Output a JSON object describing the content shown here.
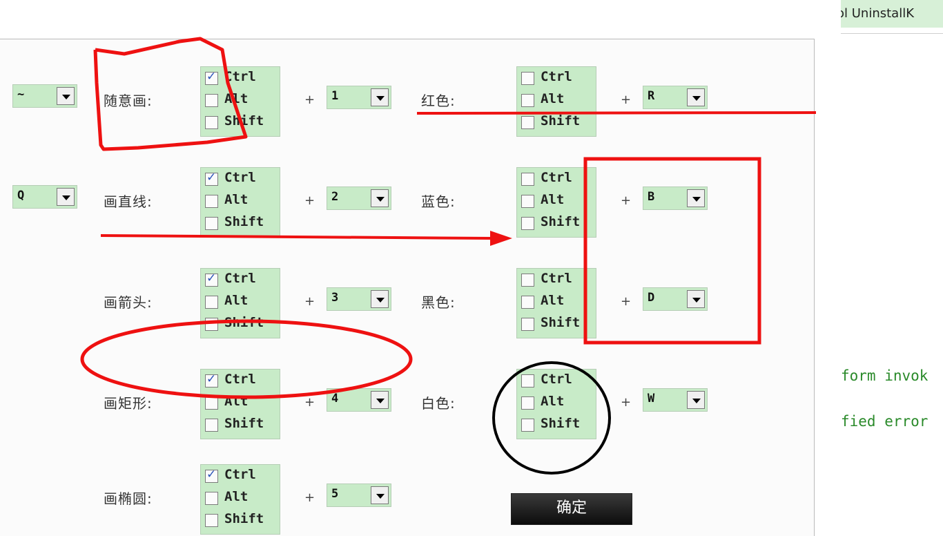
{
  "top_right_title": "ol UninstallK",
  "console": [
    "form invok",
    "fied error"
  ],
  "mode_selects": [
    "~",
    "Q"
  ],
  "tools": [
    {
      "label": "随意画:",
      "ctrl": true,
      "alt": false,
      "shift": false,
      "key": "1"
    },
    {
      "label": "画直线:",
      "ctrl": true,
      "alt": false,
      "shift": false,
      "key": "2"
    },
    {
      "label": "画箭头:",
      "ctrl": true,
      "alt": false,
      "shift": false,
      "key": "3"
    },
    {
      "label": "画矩形:",
      "ctrl": true,
      "alt": false,
      "shift": false,
      "key": "4"
    },
    {
      "label": "画椭圆:",
      "ctrl": true,
      "alt": false,
      "shift": false,
      "key": "5"
    }
  ],
  "colors": [
    {
      "label": "红色:",
      "ctrl": false,
      "alt": false,
      "shift": false,
      "key": "R"
    },
    {
      "label": "蓝色:",
      "ctrl": false,
      "alt": false,
      "shift": false,
      "key": "B"
    },
    {
      "label": "黑色:",
      "ctrl": false,
      "alt": false,
      "shift": false,
      "key": "D"
    },
    {
      "label": "白色:",
      "ctrl": false,
      "alt": false,
      "shift": false,
      "key": "W"
    }
  ],
  "modifier_labels": {
    "ctrl": "Ctrl",
    "alt": "Alt",
    "shift": "Shift"
  },
  "plus": "+",
  "ok_label": "确定",
  "annotation_colors": {
    "red": "#ee1111",
    "black": "#000000"
  }
}
